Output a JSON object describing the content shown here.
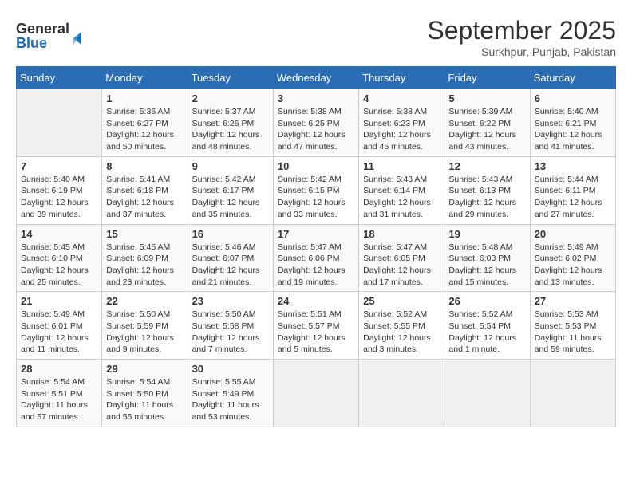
{
  "header": {
    "logo_general": "General",
    "logo_blue": "Blue",
    "month": "September 2025",
    "location": "Surkhpur, Punjab, Pakistan"
  },
  "days_of_week": [
    "Sunday",
    "Monday",
    "Tuesday",
    "Wednesday",
    "Thursday",
    "Friday",
    "Saturday"
  ],
  "weeks": [
    [
      {
        "day": "",
        "info": ""
      },
      {
        "day": "1",
        "info": "Sunrise: 5:36 AM\nSunset: 6:27 PM\nDaylight: 12 hours\nand 50 minutes."
      },
      {
        "day": "2",
        "info": "Sunrise: 5:37 AM\nSunset: 6:26 PM\nDaylight: 12 hours\nand 48 minutes."
      },
      {
        "day": "3",
        "info": "Sunrise: 5:38 AM\nSunset: 6:25 PM\nDaylight: 12 hours\nand 47 minutes."
      },
      {
        "day": "4",
        "info": "Sunrise: 5:38 AM\nSunset: 6:23 PM\nDaylight: 12 hours\nand 45 minutes."
      },
      {
        "day": "5",
        "info": "Sunrise: 5:39 AM\nSunset: 6:22 PM\nDaylight: 12 hours\nand 43 minutes."
      },
      {
        "day": "6",
        "info": "Sunrise: 5:40 AM\nSunset: 6:21 PM\nDaylight: 12 hours\nand 41 minutes."
      }
    ],
    [
      {
        "day": "7",
        "info": "Sunrise: 5:40 AM\nSunset: 6:19 PM\nDaylight: 12 hours\nand 39 minutes."
      },
      {
        "day": "8",
        "info": "Sunrise: 5:41 AM\nSunset: 6:18 PM\nDaylight: 12 hours\nand 37 minutes."
      },
      {
        "day": "9",
        "info": "Sunrise: 5:42 AM\nSunset: 6:17 PM\nDaylight: 12 hours\nand 35 minutes."
      },
      {
        "day": "10",
        "info": "Sunrise: 5:42 AM\nSunset: 6:15 PM\nDaylight: 12 hours\nand 33 minutes."
      },
      {
        "day": "11",
        "info": "Sunrise: 5:43 AM\nSunset: 6:14 PM\nDaylight: 12 hours\nand 31 minutes."
      },
      {
        "day": "12",
        "info": "Sunrise: 5:43 AM\nSunset: 6:13 PM\nDaylight: 12 hours\nand 29 minutes."
      },
      {
        "day": "13",
        "info": "Sunrise: 5:44 AM\nSunset: 6:11 PM\nDaylight: 12 hours\nand 27 minutes."
      }
    ],
    [
      {
        "day": "14",
        "info": "Sunrise: 5:45 AM\nSunset: 6:10 PM\nDaylight: 12 hours\nand 25 minutes."
      },
      {
        "day": "15",
        "info": "Sunrise: 5:45 AM\nSunset: 6:09 PM\nDaylight: 12 hours\nand 23 minutes."
      },
      {
        "day": "16",
        "info": "Sunrise: 5:46 AM\nSunset: 6:07 PM\nDaylight: 12 hours\nand 21 minutes."
      },
      {
        "day": "17",
        "info": "Sunrise: 5:47 AM\nSunset: 6:06 PM\nDaylight: 12 hours\nand 19 minutes."
      },
      {
        "day": "18",
        "info": "Sunrise: 5:47 AM\nSunset: 6:05 PM\nDaylight: 12 hours\nand 17 minutes."
      },
      {
        "day": "19",
        "info": "Sunrise: 5:48 AM\nSunset: 6:03 PM\nDaylight: 12 hours\nand 15 minutes."
      },
      {
        "day": "20",
        "info": "Sunrise: 5:49 AM\nSunset: 6:02 PM\nDaylight: 12 hours\nand 13 minutes."
      }
    ],
    [
      {
        "day": "21",
        "info": "Sunrise: 5:49 AM\nSunset: 6:01 PM\nDaylight: 12 hours\nand 11 minutes."
      },
      {
        "day": "22",
        "info": "Sunrise: 5:50 AM\nSunset: 5:59 PM\nDaylight: 12 hours\nand 9 minutes."
      },
      {
        "day": "23",
        "info": "Sunrise: 5:50 AM\nSunset: 5:58 PM\nDaylight: 12 hours\nand 7 minutes."
      },
      {
        "day": "24",
        "info": "Sunrise: 5:51 AM\nSunset: 5:57 PM\nDaylight: 12 hours\nand 5 minutes."
      },
      {
        "day": "25",
        "info": "Sunrise: 5:52 AM\nSunset: 5:55 PM\nDaylight: 12 hours\nand 3 minutes."
      },
      {
        "day": "26",
        "info": "Sunrise: 5:52 AM\nSunset: 5:54 PM\nDaylight: 12 hours\nand 1 minute."
      },
      {
        "day": "27",
        "info": "Sunrise: 5:53 AM\nSunset: 5:53 PM\nDaylight: 11 hours\nand 59 minutes."
      }
    ],
    [
      {
        "day": "28",
        "info": "Sunrise: 5:54 AM\nSunset: 5:51 PM\nDaylight: 11 hours\nand 57 minutes."
      },
      {
        "day": "29",
        "info": "Sunrise: 5:54 AM\nSunset: 5:50 PM\nDaylight: 11 hours\nand 55 minutes."
      },
      {
        "day": "30",
        "info": "Sunrise: 5:55 AM\nSunset: 5:49 PM\nDaylight: 11 hours\nand 53 minutes."
      },
      {
        "day": "",
        "info": ""
      },
      {
        "day": "",
        "info": ""
      },
      {
        "day": "",
        "info": ""
      },
      {
        "day": "",
        "info": ""
      }
    ]
  ]
}
